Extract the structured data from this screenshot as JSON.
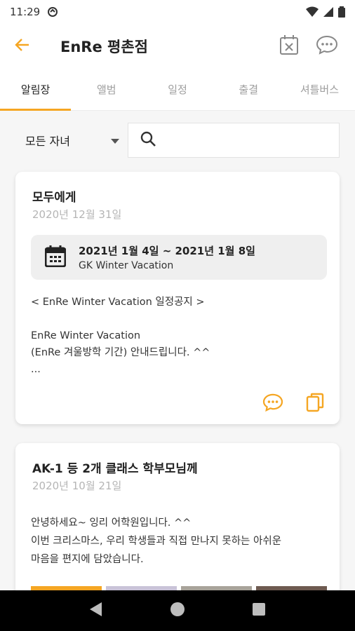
{
  "status_bar": {
    "time": "11:29"
  },
  "header": {
    "title": "EnRe 평촌점"
  },
  "tabs": [
    {
      "label": "알림장",
      "active": true
    },
    {
      "label": "앨범"
    },
    {
      "label": "일정"
    },
    {
      "label": "출결"
    },
    {
      "label": "셔틀버스"
    }
  ],
  "filter": {
    "child_select_value": "모든 자녀",
    "search_placeholder": ""
  },
  "accent_color": "#f5a623",
  "notices": [
    {
      "title": "모두에게",
      "date": "2020년 12월 31일",
      "event": {
        "range": "2021년 1월 4일 ~ 2021년 1월 8일",
        "name": "GK Winter Vacation"
      },
      "body": [
        "< EnRe Winter Vacation 일정공지 >",
        "",
        "EnRe Winter Vacation",
        "(EnRe 겨울방학 기간) 안내드립니다. ^^",
        "..."
      ]
    },
    {
      "title": "AK-1 등 2개 클래스 학부모님께",
      "date": "2020년 10월 21일",
      "body": [
        "안녕하세요~ 잉리 어학원입니다. ^^",
        "이번 크리스마스, 우리 학생들과 직접 만나지 못하는 아쉬운",
        "마음을 편지에 담았습니다."
      ]
    }
  ]
}
